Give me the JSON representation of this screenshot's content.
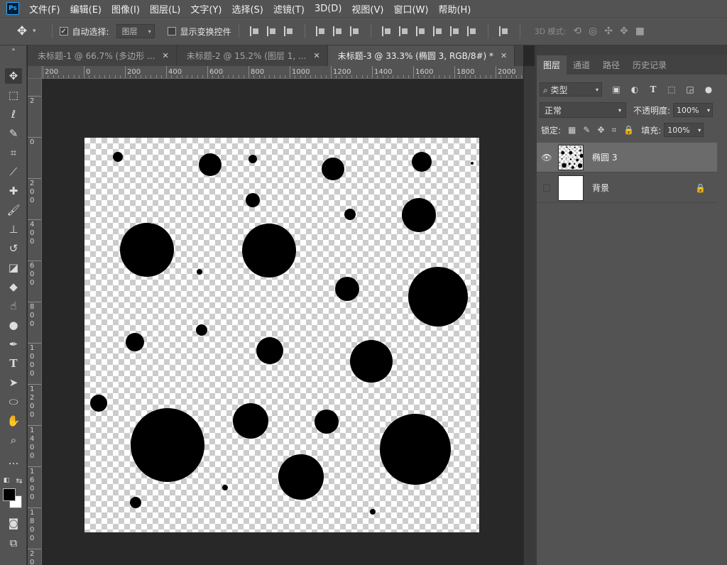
{
  "app": {
    "logo": "Ps"
  },
  "menu": [
    "文件(F)",
    "编辑(E)",
    "图像(I)",
    "图层(L)",
    "文字(Y)",
    "选择(S)",
    "滤镜(T)",
    "3D(D)",
    "视图(V)",
    "窗口(W)",
    "帮助(H)"
  ],
  "options": {
    "tool_icon": "move-tool-icon",
    "auto_select_label": "自动选择:",
    "auto_select_checked": true,
    "auto_select_value": "图层",
    "show_transform_label": "显示变换控件",
    "show_transform_checked": false,
    "mode_3d_label": "3D 模式:"
  },
  "tools": [
    "move-tool",
    "marquee-tool",
    "lasso-tool",
    "quick-select-tool",
    "crop-tool",
    "eyedropper-tool",
    "healing-brush-tool",
    "brush-tool",
    "clone-stamp-tool",
    "history-brush-tool",
    "eraser-tool",
    "paint-bucket-tool",
    "smudge-tool",
    "sponge-tool",
    "pen-tool",
    "type-tool",
    "path-selection-tool",
    "ellipse-tool",
    "hand-tool",
    "zoom-tool",
    "more-tools"
  ],
  "colors": {
    "foreground": "#000000",
    "background": "#ffffff",
    "accent": "#31a8ff"
  },
  "tabs": [
    {
      "label": "未标题-1 @ 66.7% (多边形 ...",
      "active": false
    },
    {
      "label": "未标题-2 @ 15.2% (图层 1, ...",
      "active": false
    },
    {
      "label": "未标题-3 @ 33.3% (椭圆 3, RGB/8#) *",
      "active": true
    }
  ],
  "ruler_top": [
    "200",
    "0",
    "200",
    "400",
    "600",
    "800",
    "1000",
    "1200",
    "1400",
    "1600",
    "1800",
    "2000"
  ],
  "ruler_left": [
    "2",
    "0",
    "2\n0\n0",
    "4\n0\n0",
    "6\n0\n0",
    "8\n0\n0",
    "1\n0\n0\n0",
    "1\n2\n0\n0",
    "1\n4\n0\n0",
    "1\n6\n0\n0",
    "1\n8\n0\n0",
    "2\n0\n0\n0"
  ],
  "panel": {
    "tabs": [
      {
        "label": "图层",
        "active": true
      },
      {
        "label": "通道",
        "active": false
      },
      {
        "label": "路径",
        "active": false
      },
      {
        "label": "历史记录",
        "active": false
      }
    ],
    "filter_label": "类型",
    "blend_mode": "正常",
    "opacity_label": "不透明度:",
    "opacity_value": "100%",
    "lock_label": "锁定:",
    "fill_label": "填充:",
    "fill_value": "100%",
    "layers": [
      {
        "name": "椭圆 3",
        "visible": true,
        "selected": true,
        "locked": false
      },
      {
        "name": "背景",
        "visible": false,
        "selected": false,
        "locked": true
      }
    ]
  }
}
